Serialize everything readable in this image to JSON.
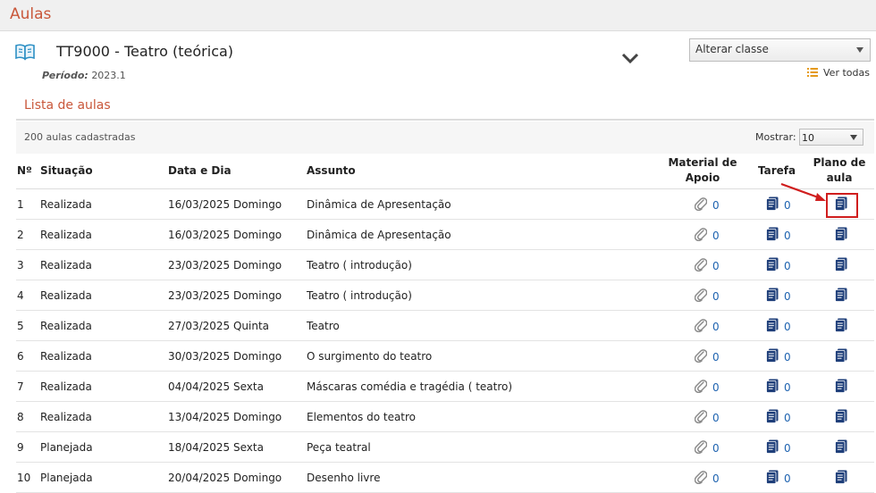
{
  "header": {
    "title": "Aulas"
  },
  "course": {
    "code": "TT9000",
    "separator": " - ",
    "name": "Teatro (teórica)",
    "periodo_label": "Período:",
    "periodo_value": "2023.1"
  },
  "controls": {
    "class_select": "Alterar classe",
    "ver_todas": "Ver todas"
  },
  "list": {
    "title": "Lista de aulas",
    "count_text": "200 aulas cadastradas",
    "mostrar_label": "Mostrar:",
    "mostrar_value": "10"
  },
  "table": {
    "headers": {
      "num": "Nº",
      "situacao": "Situação",
      "data": "Data e Dia",
      "assunto": "Assunto",
      "material_1": "Material de",
      "material_2": "Apoio",
      "tarefa": "Tarefa",
      "plano_1": "Plano de",
      "plano_2": "aula"
    },
    "rows": [
      {
        "num": "1",
        "situacao": "Realizada",
        "data": "16/03/2025 Domingo",
        "assunto": "Dinâmica de Apresentação",
        "material": "0",
        "tarefa": "0"
      },
      {
        "num": "2",
        "situacao": "Realizada",
        "data": "16/03/2025 Domingo",
        "assunto": "Dinâmica de Apresentação",
        "material": "0",
        "tarefa": "0"
      },
      {
        "num": "3",
        "situacao": "Realizada",
        "data": "23/03/2025 Domingo",
        "assunto": "Teatro ( introdução)",
        "material": "0",
        "tarefa": "0"
      },
      {
        "num": "4",
        "situacao": "Realizada",
        "data": "23/03/2025 Domingo",
        "assunto": "Teatro ( introdução)",
        "material": "0",
        "tarefa": "0"
      },
      {
        "num": "5",
        "situacao": "Realizada",
        "data": "27/03/2025 Quinta",
        "assunto": "Teatro",
        "material": "0",
        "tarefa": "0"
      },
      {
        "num": "6",
        "situacao": "Realizada",
        "data": "30/03/2025 Domingo",
        "assunto": "O surgimento do teatro",
        "material": "0",
        "tarefa": "0"
      },
      {
        "num": "7",
        "situacao": "Realizada",
        "data": "04/04/2025 Sexta",
        "assunto": "Máscaras comédia e tragédia ( teatro)",
        "material": "0",
        "tarefa": "0"
      },
      {
        "num": "8",
        "situacao": "Realizada",
        "data": "13/04/2025 Domingo",
        "assunto": "Elementos do teatro",
        "material": "0",
        "tarefa": "0"
      },
      {
        "num": "9",
        "situacao": "Planejada",
        "data": "18/04/2025 Sexta",
        "assunto": "Peça teatral",
        "material": "0",
        "tarefa": "0"
      },
      {
        "num": "10",
        "situacao": "Planejada",
        "data": "20/04/2025 Domingo",
        "assunto": "Desenho livre",
        "material": "0",
        "tarefa": "0"
      }
    ]
  },
  "icons": {
    "book": "book-open-icon",
    "chevron": "chevron-down-icon",
    "list": "list-icon",
    "material": "paperclip-icon",
    "tarefa": "document-icon",
    "plano": "document-icon"
  },
  "colors": {
    "accent": "#c9573a",
    "link": "#1e63b0",
    "doc_icon": "#1f3f7a",
    "highlight": "#d01e1e"
  }
}
